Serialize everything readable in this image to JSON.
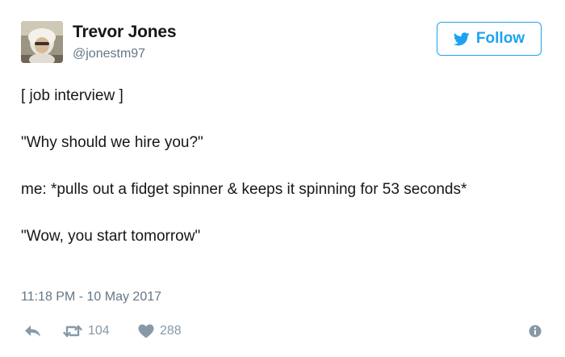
{
  "author": {
    "display_name": "Trevor Jones",
    "handle": "@jonestm97"
  },
  "follow_button": {
    "label": "Follow",
    "icon": "twitter-bird-icon"
  },
  "tweet": {
    "lines": [
      "[ job interview ]",
      "\"Why should we hire you?\"",
      "me: *pulls out a fidget spinner & keeps it spinning for 53 seconds*",
      "\"Wow, you start tomorrow\""
    ],
    "timestamp": "11:18 PM - 10 May 2017"
  },
  "actions": {
    "reply_icon": "reply-icon",
    "retweet_icon": "retweet-icon",
    "retweet_count": "104",
    "like_icon": "heart-icon",
    "like_count": "288",
    "info_icon": "info-icon"
  },
  "colors": {
    "accent": "#1da1f2",
    "text": "#14171a",
    "muted": "#657786",
    "action": "#8899a6"
  }
}
